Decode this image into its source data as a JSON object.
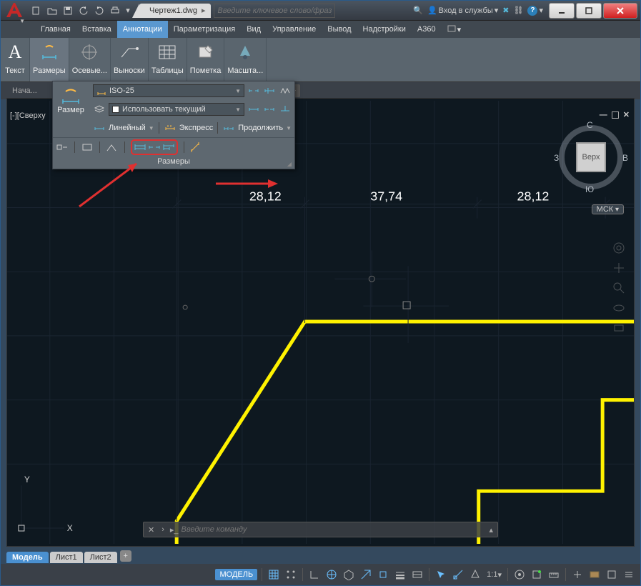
{
  "title": {
    "filename": "Чертеж1.dwg",
    "search_placeholder": "Введите ключевое слово/фразу",
    "login": "Вход в службы"
  },
  "menu": {
    "items": [
      "Главная",
      "Вставка",
      "Аннотации",
      "Параметризация",
      "Вид",
      "Управление",
      "Вывод",
      "Надстройки",
      "A360"
    ],
    "active_index": 2
  },
  "ribbon": {
    "panels": [
      {
        "label": "Текст"
      },
      {
        "label": "Размеры"
      },
      {
        "label": "Осевые..."
      },
      {
        "label": "Выноски"
      },
      {
        "label": "Таблицы"
      },
      {
        "label": "Пометка"
      },
      {
        "label": "Масшта..."
      }
    ],
    "active_index": 1
  },
  "tabs": {
    "start": "Нача...",
    "plus": "+"
  },
  "dim_panel": {
    "big_label": "Размер",
    "style": "ISO-25",
    "layer": "Использовать текущий",
    "linear": "Линейный",
    "express": "Экспресс",
    "continue": "Продолжить",
    "footer": "Размеры"
  },
  "viewport": {
    "label": "[-][Сверху",
    "viewcube": "Верх",
    "c": "С",
    "e": "В",
    "w": "З",
    "yu": "Ю",
    "msk": "МСК"
  },
  "dimensions": {
    "d1": "28,12",
    "d2": "37,74",
    "d3": "28,12"
  },
  "ucs": {
    "x": "X",
    "y": "Y"
  },
  "cmd": {
    "placeholder": "Введите команду"
  },
  "layout": {
    "tabs": [
      "Модель",
      "Лист1",
      "Лист2"
    ],
    "active_index": 0
  },
  "status": {
    "model": "МОДЕЛЬ",
    "scale": "1:1"
  }
}
